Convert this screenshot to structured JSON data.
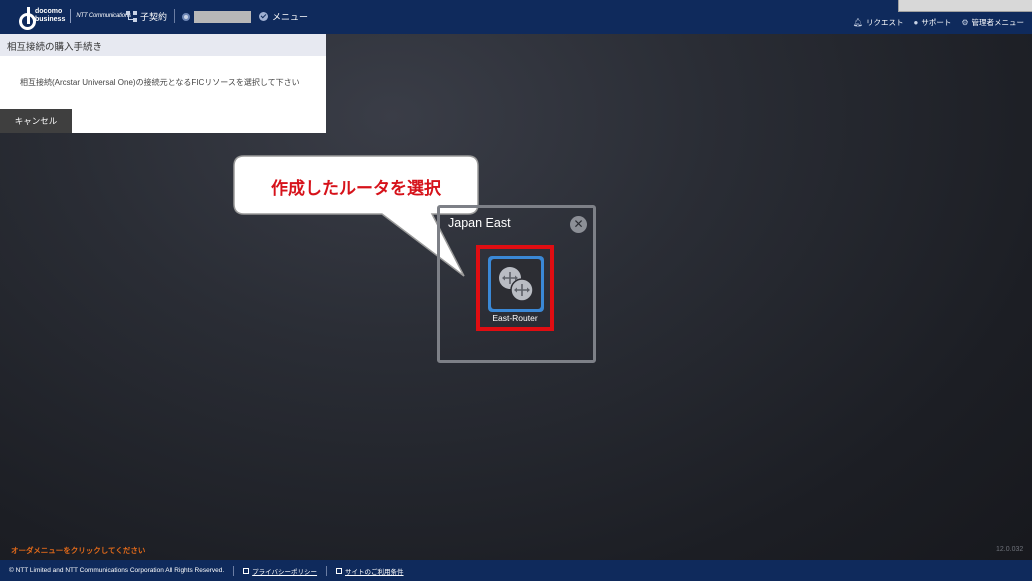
{
  "header": {
    "logo_top": "docomo",
    "logo_bottom": "business",
    "logo_partner": "NTT Communications",
    "contract_label": "子契約",
    "menu_label": "メニュー",
    "right_items": [
      {
        "label": "リクエスト",
        "icon": "bell-icon"
      },
      {
        "label": "サポート",
        "icon": "question-icon"
      },
      {
        "label": "管理者メニュー",
        "icon": "gear-icon"
      }
    ]
  },
  "panel": {
    "title": "相互接続の購入手続き",
    "instruction": "相互接続(Arcstar Universal One)の接続元となるFICリソースを選択して下さい",
    "cancel_label": "キャンセル"
  },
  "region": {
    "title": "Japan East",
    "close_glyph": "✕",
    "router_label": "East-Router"
  },
  "callout": {
    "text": "作成したルータを選択",
    "color": "#d6121a"
  },
  "order_hint": "オーダメニューをクリックしてください",
  "version": "12.0.032",
  "footer": {
    "copyright": "© NTT Limited and NTT Communications Corporation All Rights Reserved.",
    "privacy_label": "プライバシーポリシー",
    "terms_label": "サイトのご利用条件"
  },
  "colors": {
    "header_bg": "#0f2a5c",
    "accent_red": "#e00d12",
    "router_blue": "#3a88d6",
    "hint_orange": "#e36a1a"
  }
}
